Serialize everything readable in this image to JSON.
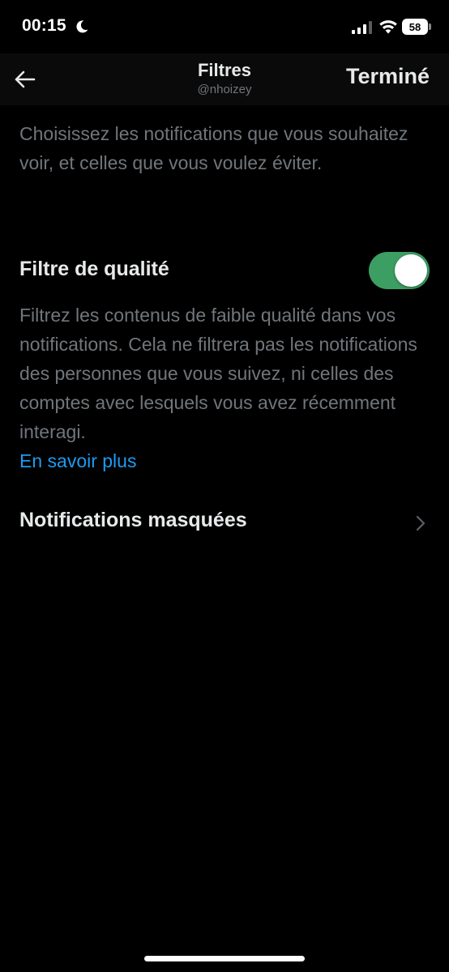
{
  "status_bar": {
    "time": "00:15",
    "battery_level": "58",
    "icons": [
      "moon-icon",
      "signal-icon",
      "wifi-icon",
      "battery-icon"
    ]
  },
  "header": {
    "back_icon": "arrow-left-icon",
    "title": "Filtres",
    "subtitle": "@nhoizey",
    "done_label": "Terminé"
  },
  "content": {
    "intro": "Choisissez les notifications que vous souhaitez voir, et celles que vous voulez éviter.",
    "quality_filter": {
      "title": "Filtre de qualité",
      "enabled": true,
      "description": "Filtrez les contenus de faible qualité dans vos notifications. Cela ne filtrera pas les notifications des personnes que vous suivez, ni celles des comptes avec lesquels vous avez récemment interagi.",
      "learn_more": "En savoir plus"
    },
    "masked_notifications": {
      "label": "Notifications masquées",
      "icon": "chevron-right-icon"
    }
  },
  "colors": {
    "background": "#000000",
    "header_background": "#0a0a0a",
    "primary_text": "#e7e9ea",
    "secondary_text": "#71767b",
    "link": "#1d9bf0",
    "toggle_on": "#3d9e63"
  }
}
